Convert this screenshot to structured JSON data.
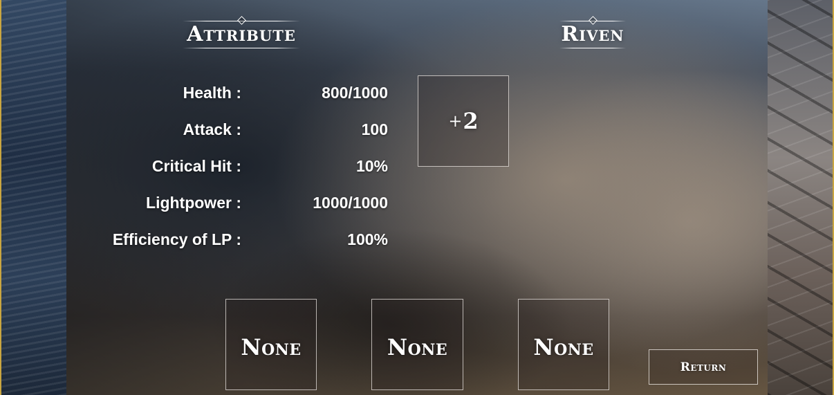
{
  "attribute": {
    "title": "Attribute",
    "stats": [
      {
        "label": "Health :",
        "value": "800/1000"
      },
      {
        "label": "Attack :",
        "value": "100"
      },
      {
        "label": "Critical Hit :",
        "value": "10%"
      },
      {
        "label": "Lightpower :",
        "value": "1000/1000"
      },
      {
        "label": "Efficiency of LP :",
        "value": "100%"
      }
    ]
  },
  "riven": {
    "title": "Riven",
    "slot_plus": "+",
    "slot_value": "2"
  },
  "skill_slots": [
    "None",
    "None",
    "None"
  ],
  "return_button": "Return",
  "colors": {
    "frame_gold": "#caa640",
    "slot_border": "#ebe6e1",
    "text": "#ffffff"
  }
}
